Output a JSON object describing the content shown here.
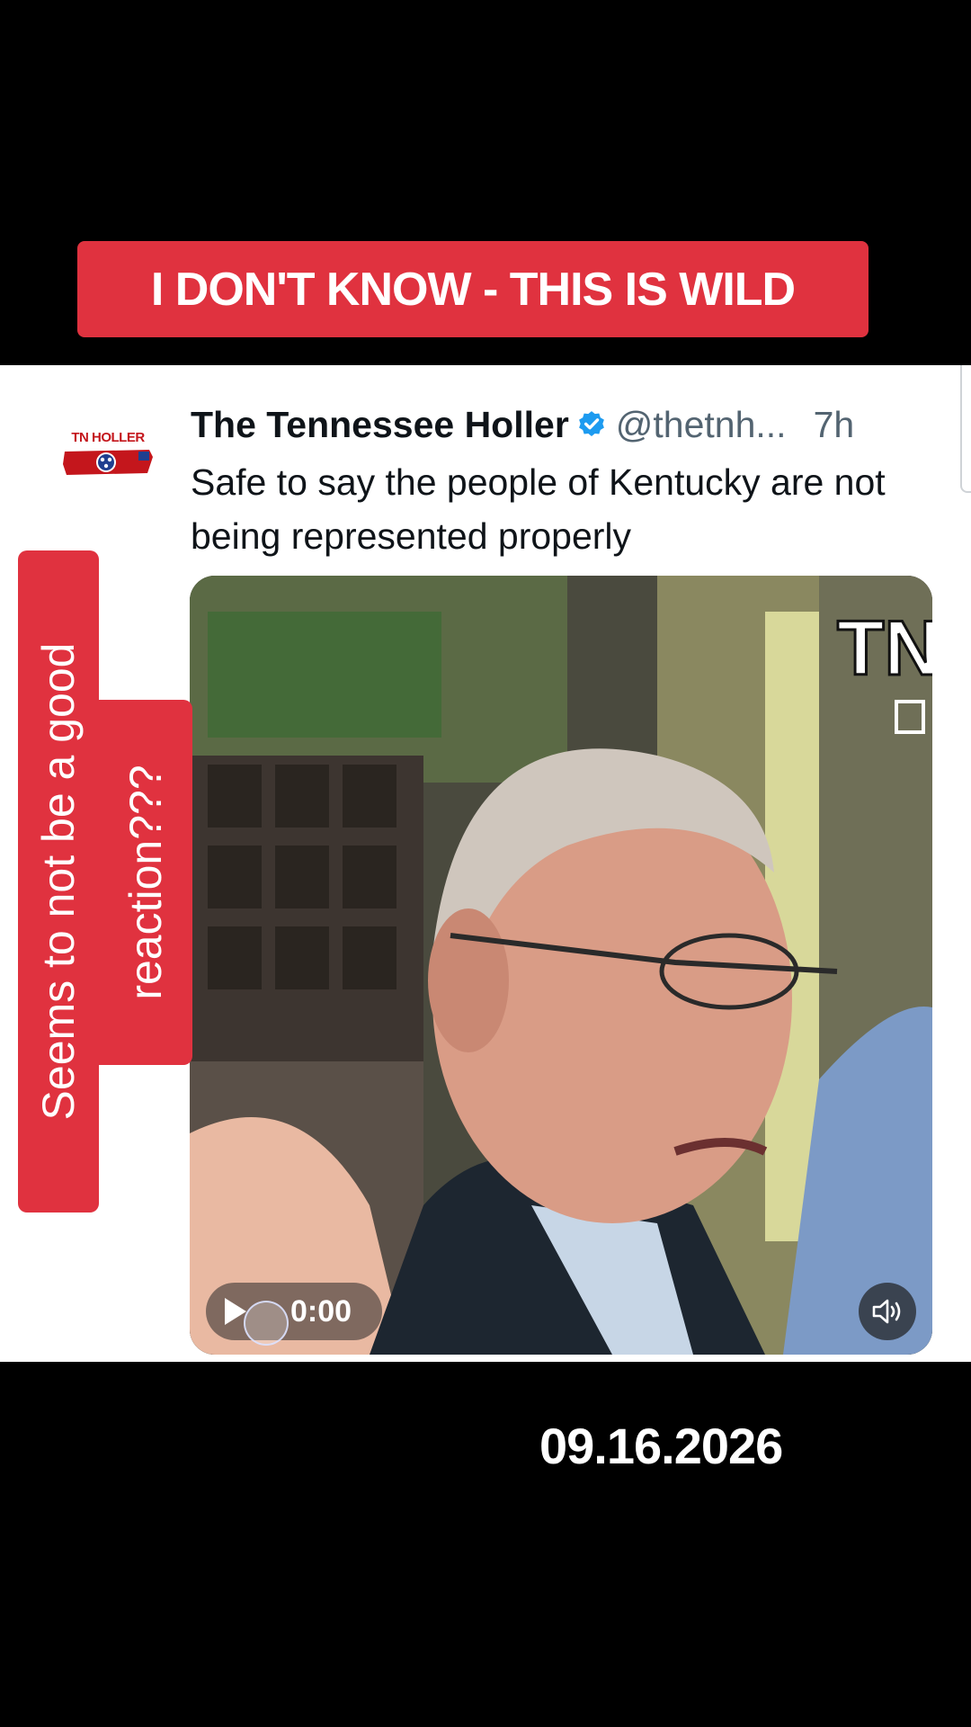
{
  "headline": "I DON'T KNOW - THIS IS WILD",
  "tweet": {
    "logo_text": "TN HOLLER",
    "author_name": "The Tennessee Holler",
    "handle": "@thetnh...",
    "time": "7h",
    "text": "Safe to say the people of Kentucky are not being represented properly",
    "video": {
      "timecode": "0:00",
      "watermark": "TN"
    }
  },
  "side_caption": {
    "line1": "Seems to not be a good",
    "line2": "reaction???"
  },
  "date_stamp": "09.16.2026",
  "colors": {
    "caption_red": "#e0323f",
    "verified_blue": "#1d9bf0"
  }
}
